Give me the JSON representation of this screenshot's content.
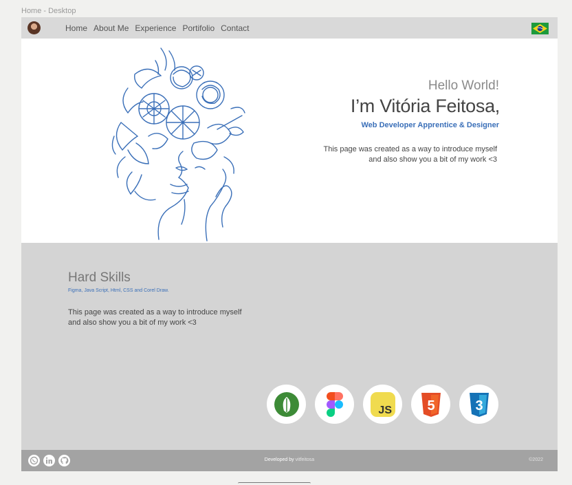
{
  "frame": {
    "label": "Home - Desktop"
  },
  "nav": {
    "links": [
      "Home",
      "About Me",
      "Experience",
      "Portifolio",
      "Contact"
    ]
  },
  "hero": {
    "greeting": "Hello World!",
    "name": "I’m Vitória Feitosa,",
    "role": "Web Developer Apprentice & Designer",
    "intro_line1": "This page was created as a way to introduce myself",
    "intro_line2": "and also show you a bit of my work <3"
  },
  "skills": {
    "title": "Hard Skills",
    "list": "Figma, Java Script, Html, CSS and Corel Draw.",
    "text_line1": "This page was created as a way to introduce myself",
    "text_line2": "and also show you a bit of my work <3",
    "icons": [
      "coreldraw-icon",
      "figma-icon",
      "javascript-icon",
      "html5-icon",
      "css3-icon"
    ],
    "js_label": "JS",
    "html_label": "5",
    "css_label": "3"
  },
  "footer": {
    "developed_prefix": "Developed by",
    "developed_name": "vitfeitosa",
    "copyright": "©2022",
    "social": [
      "whatsapp-icon",
      "linkedin-icon",
      "github-icon"
    ]
  },
  "colors": {
    "accent_blue": "#3a6fb8",
    "nav_bg": "#d9d9d9",
    "skills_bg": "#d4d4d4",
    "footer_bg": "#a3a3a3"
  }
}
